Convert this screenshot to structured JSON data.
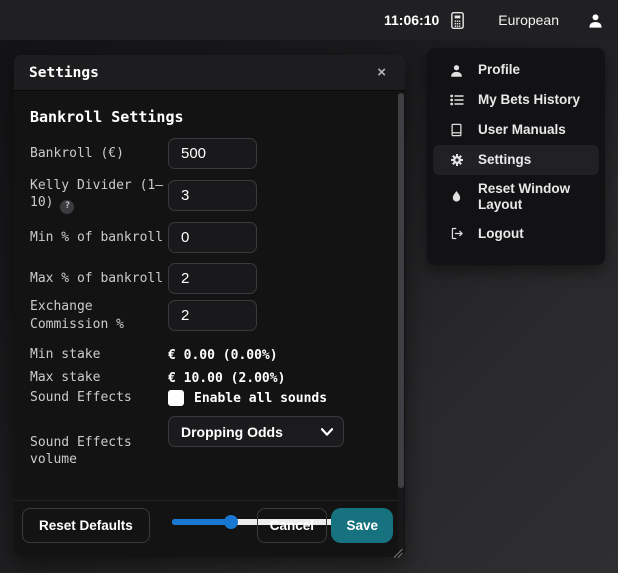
{
  "topbar": {
    "time": "11:06:10",
    "odds_format": "European"
  },
  "menu": {
    "items": [
      {
        "label": "Profile",
        "icon": "profile-icon",
        "active": false
      },
      {
        "label": "My Bets History",
        "icon": "bets-history-icon",
        "active": false
      },
      {
        "label": "User Manuals",
        "icon": "user-manuals-icon",
        "active": false
      },
      {
        "label": "Settings",
        "icon": "settings-gear-icon",
        "active": true
      },
      {
        "label": "Reset Window Layout",
        "icon": "reset-layout-icon",
        "active": false
      },
      {
        "label": "Logout",
        "icon": "logout-icon",
        "active": false
      }
    ]
  },
  "dialog": {
    "title": "Settings",
    "close_label": "×",
    "section_title": "Bankroll Settings",
    "fields": {
      "bankroll": {
        "label": "Bankroll (€)",
        "value": "500"
      },
      "kelly_divider": {
        "label": "Kelly Divider (1–10)",
        "help": "?",
        "value": "3"
      },
      "min_pct": {
        "label": "Min % of bankroll",
        "value": "0"
      },
      "max_pct": {
        "label": "Max % of bankroll",
        "value": "2"
      },
      "exchange_commission": {
        "label": "Exchange Commission %",
        "value": "2"
      },
      "min_stake": {
        "label": "Min stake",
        "value": "€ 0.00 (0.00%)"
      },
      "max_stake": {
        "label": "Max stake",
        "value": "€ 10.00 (2.00%)"
      },
      "sound_effects": {
        "label": "Sound Effects",
        "checkbox_label": "Enable all sounds",
        "checked": false
      },
      "sound_effects_type": {
        "selected": "Dropping Odds"
      },
      "sound_effects_volume": {
        "label": "Sound Effects volume",
        "percent": 33
      }
    },
    "buttons": {
      "reset_defaults": "Reset Defaults",
      "cancel": "Cancel",
      "save": "Save"
    }
  },
  "colors": {
    "save_button": "#17727f",
    "slider_fill": "#1877d1",
    "slider_track": "#ececec"
  }
}
